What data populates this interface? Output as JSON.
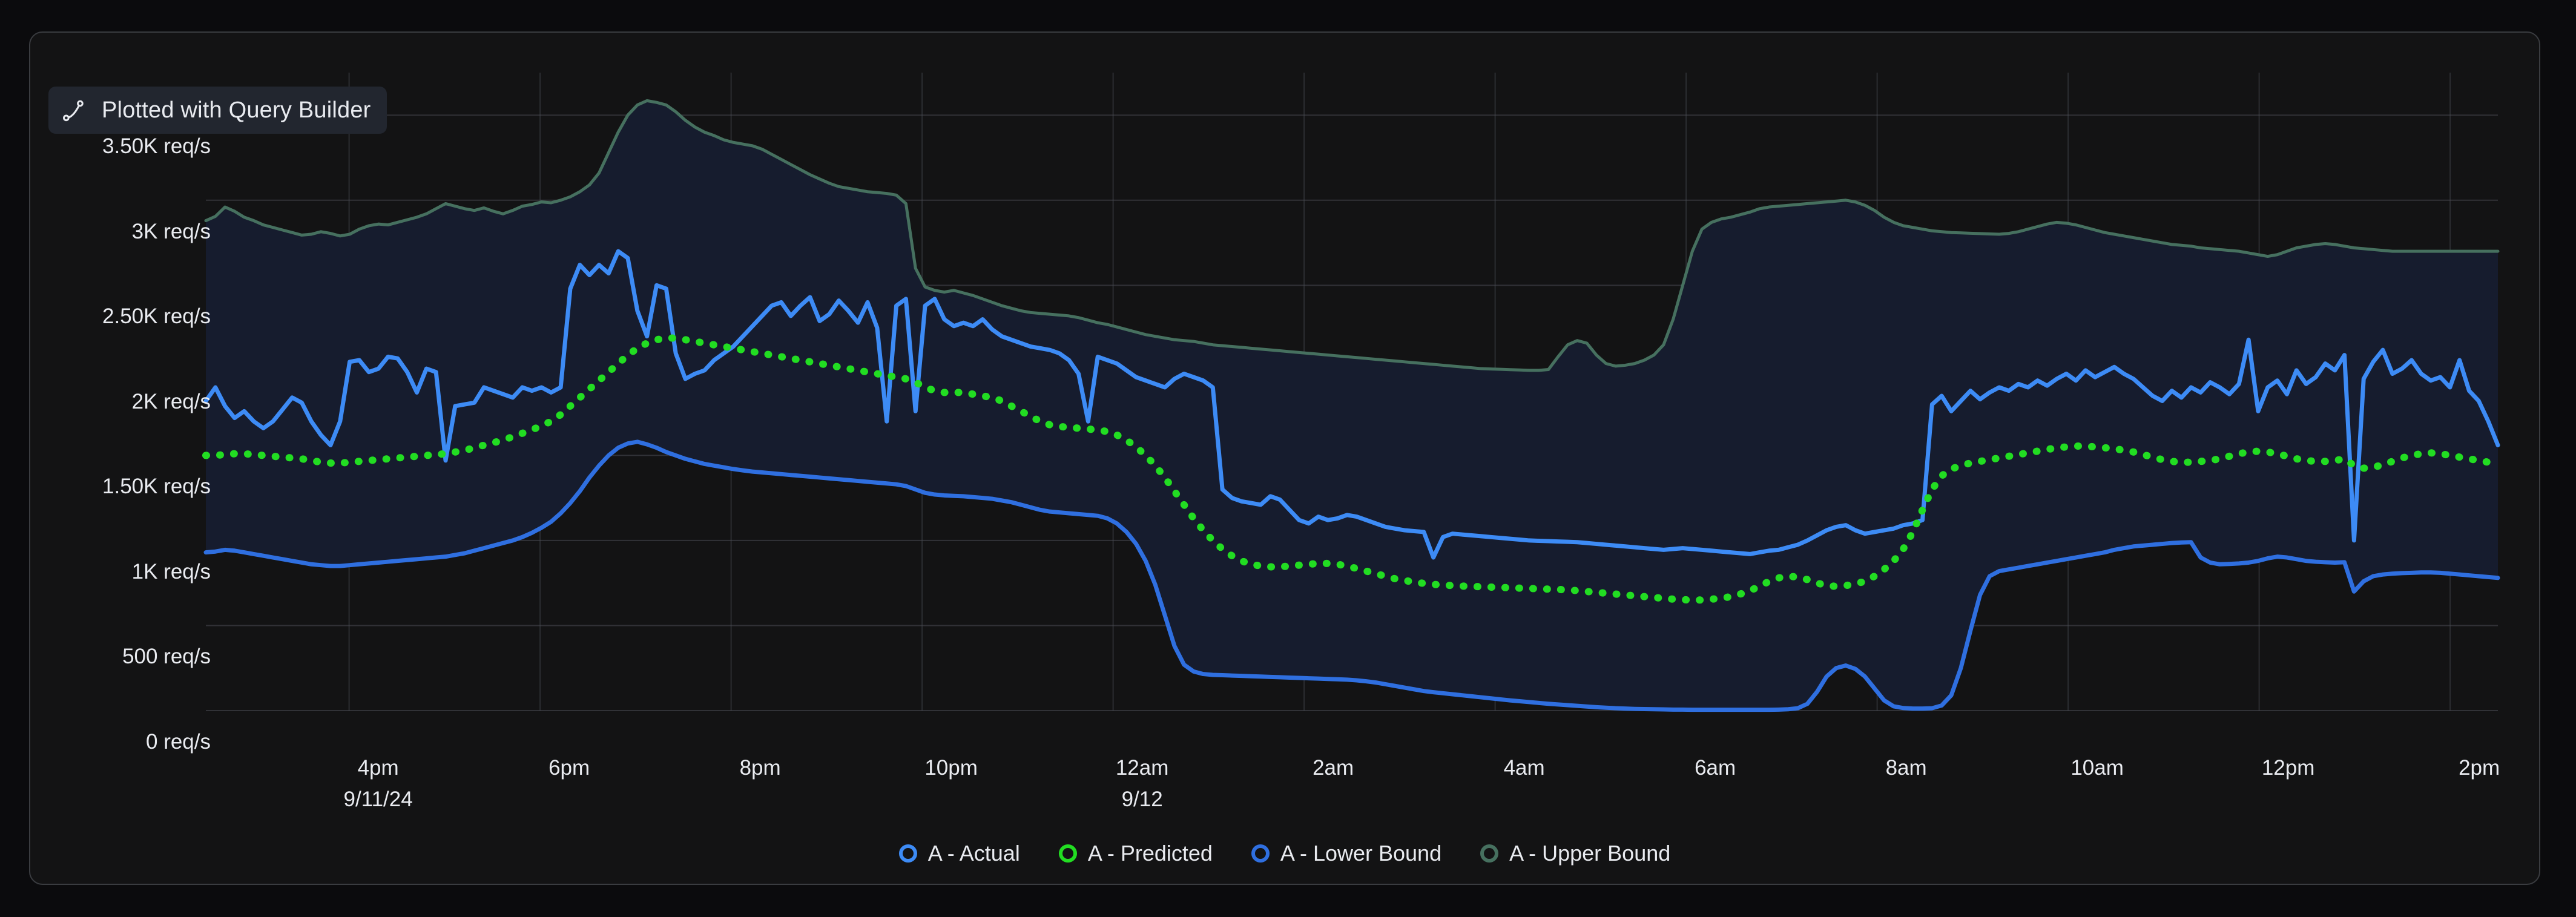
{
  "panel": {
    "badge": {
      "icon": "curve-plot-icon",
      "text": "Plotted with  Query Builder"
    }
  },
  "colors": {
    "page_background": "#0b0b0d",
    "panel_background": "#131314",
    "panel_border": "#3a3c40",
    "badge_background": "#22262f",
    "text": "#e9ebf0",
    "gridline": "#4a4d55",
    "band_fill": "#161c2e",
    "actual": "#3d8bf5",
    "predicted": "#22dd22",
    "lower_bound": "#2f6fe0",
    "upper_bound": "#46705f"
  },
  "chart_data": {
    "type": "line",
    "title": "",
    "subtitle": "",
    "xlabel": "",
    "ylabel": "req/s",
    "grid": true,
    "legend_position": "bottom",
    "ylim": [
      0,
      3750
    ],
    "yticks": [
      0,
      500,
      1000,
      1500,
      2000,
      2500,
      3000,
      3500
    ],
    "ytick_labels": [
      "0 req/s",
      "500 req/s",
      "1K req/s",
      "1.50K req/s",
      "2K req/s",
      "2.50K req/s",
      "3K req/s",
      "3.50K req/s"
    ],
    "x_start_hour": 14.5,
    "x_end_hour": 38.5,
    "xticks": [
      {
        "time": "4pm",
        "date": "9/11/24",
        "hour": 16
      },
      {
        "time": "6pm",
        "date": "",
        "hour": 18
      },
      {
        "time": "8pm",
        "date": "",
        "hour": 20
      },
      {
        "time": "10pm",
        "date": "",
        "hour": 22
      },
      {
        "time": "12am",
        "date": "9/12",
        "hour": 24
      },
      {
        "time": "2am",
        "date": "",
        "hour": 26
      },
      {
        "time": "4am",
        "date": "",
        "hour": 28
      },
      {
        "time": "6am",
        "date": "",
        "hour": 30
      },
      {
        "time": "8am",
        "date": "",
        "hour": 32
      },
      {
        "time": "10am",
        "date": "",
        "hour": 34
      },
      {
        "time": "12pm",
        "date": "",
        "hour": 36
      },
      {
        "time": "2pm",
        "date": "",
        "hour": 38
      }
    ],
    "legend": [
      {
        "label": "A - Actual",
        "color": "#3d8bf5"
      },
      {
        "label": "A - Predicted",
        "color": "#22dd22"
      },
      {
        "label": "A - Lower Bound",
        "color": "#2f6fe0"
      },
      {
        "label": "A - Upper Bound",
        "color": "#46705f"
      }
    ],
    "series": [
      {
        "name": "A - Upper Bound",
        "color": "#46705f",
        "style": "solid",
        "values": [
          2880,
          2905,
          2960,
          2935,
          2900,
          2880,
          2855,
          2840,
          2825,
          2810,
          2795,
          2800,
          2815,
          2805,
          2790,
          2800,
          2830,
          2850,
          2860,
          2855,
          2870,
          2885,
          2900,
          2920,
          2950,
          2980,
          2965,
          2950,
          2940,
          2955,
          2935,
          2920,
          2940,
          2965,
          2975,
          2990,
          2985,
          3000,
          3020,
          3050,
          3090,
          3160,
          3280,
          3400,
          3500,
          3560,
          3585,
          3575,
          3560,
          3520,
          3470,
          3430,
          3400,
          3380,
          3355,
          3340,
          3330,
          3320,
          3300,
          3270,
          3240,
          3210,
          3180,
          3150,
          3125,
          3100,
          3080,
          3070,
          3060,
          3050,
          3045,
          3040,
          3030,
          2980,
          2600,
          2490,
          2470,
          2460,
          2470,
          2455,
          2440,
          2420,
          2400,
          2380,
          2365,
          2350,
          2340,
          2335,
          2330,
          2325,
          2320,
          2310,
          2295,
          2280,
          2270,
          2255,
          2240,
          2225,
          2210,
          2200,
          2190,
          2180,
          2175,
          2170,
          2160,
          2150,
          2145,
          2140,
          2135,
          2130,
          2125,
          2120,
          2115,
          2110,
          2105,
          2100,
          2095,
          2090,
          2085,
          2080,
          2075,
          2070,
          2065,
          2060,
          2055,
          2050,
          2045,
          2040,
          2035,
          2030,
          2025,
          2020,
          2015,
          2010,
          2008,
          2006,
          2004,
          2002,
          2000,
          2000,
          2005,
          2080,
          2150,
          2175,
          2160,
          2090,
          2040,
          2025,
          2030,
          2040,
          2060,
          2090,
          2150,
          2300,
          2500,
          2700,
          2830,
          2870,
          2890,
          2900,
          2915,
          2930,
          2950,
          2960,
          2965,
          2970,
          2975,
          2980,
          2985,
          2990,
          2995,
          3000,
          2990,
          2970,
          2940,
          2900,
          2870,
          2850,
          2840,
          2830,
          2820,
          2815,
          2810,
          2808,
          2806,
          2804,
          2802,
          2800,
          2805,
          2815,
          2830,
          2845,
          2860,
          2870,
          2865,
          2855,
          2840,
          2825,
          2810,
          2800,
          2790,
          2780,
          2770,
          2760,
          2750,
          2740,
          2735,
          2730,
          2720,
          2715,
          2710,
          2705,
          2700,
          2690,
          2680,
          2670,
          2680,
          2700,
          2720,
          2730,
          2740,
          2745,
          2740,
          2730,
          2720,
          2715,
          2710,
          2705,
          2700,
          2700,
          2700,
          2700,
          2700,
          2700,
          2700,
          2700,
          2700,
          2700,
          2700,
          2700
        ]
      },
      {
        "name": "A - Actual",
        "color": "#3d8bf5",
        "style": "solid",
        "values": [
          1820,
          1900,
          1790,
          1720,
          1760,
          1700,
          1660,
          1700,
          1770,
          1840,
          1810,
          1700,
          1620,
          1560,
          1700,
          2050,
          2060,
          1990,
          2010,
          2080,
          2070,
          1990,
          1870,
          2010,
          1990,
          1470,
          1790,
          1800,
          1810,
          1900,
          1880,
          1860,
          1840,
          1900,
          1880,
          1900,
          1870,
          1900,
          2480,
          2620,
          2560,
          2620,
          2570,
          2700,
          2660,
          2350,
          2200,
          2500,
          2480,
          2100,
          1950,
          1980,
          2000,
          2060,
          2100,
          2140,
          2200,
          2260,
          2320,
          2380,
          2400,
          2320,
          2380,
          2430,
          2290,
          2330,
          2410,
          2350,
          2280,
          2400,
          2250,
          1700,
          2380,
          2420,
          1760,
          2380,
          2420,
          2300,
          2260,
          2280,
          2260,
          2300,
          2240,
          2200,
          2180,
          2160,
          2140,
          2130,
          2120,
          2100,
          2060,
          1980,
          1700,
          2080,
          2060,
          2040,
          2000,
          1960,
          1940,
          1920,
          1900,
          1950,
          1980,
          1960,
          1940,
          1900,
          1300,
          1250,
          1230,
          1220,
          1210,
          1260,
          1240,
          1180,
          1120,
          1100,
          1140,
          1120,
          1130,
          1150,
          1140,
          1120,
          1100,
          1080,
          1070,
          1060,
          1055,
          1050,
          900,
          1020,
          1040,
          1035,
          1030,
          1025,
          1020,
          1015,
          1010,
          1005,
          1000,
          998,
          996,
          994,
          992,
          990,
          985,
          980,
          975,
          970,
          965,
          960,
          955,
          950,
          945,
          950,
          955,
          950,
          945,
          940,
          935,
          930,
          925,
          920,
          930,
          940,
          945,
          960,
          975,
          1000,
          1030,
          1060,
          1080,
          1090,
          1060,
          1040,
          1050,
          1060,
          1070,
          1090,
          1100,
          1120,
          1800,
          1850,
          1760,
          1820,
          1880,
          1830,
          1870,
          1900,
          1880,
          1920,
          1900,
          1940,
          1910,
          1950,
          1980,
          1940,
          2000,
          1960,
          1990,
          2020,
          1980,
          1950,
          1900,
          1850,
          1820,
          1880,
          1840,
          1900,
          1870,
          1930,
          1900,
          1860,
          1920,
          2180,
          1760,
          1900,
          1940,
          1860,
          2000,
          1920,
          1960,
          2040,
          2000,
          2090,
          1000,
          1950,
          2050,
          2120,
          1980,
          2010,
          2060,
          1980,
          1940,
          1960,
          1900,
          2060,
          1880,
          1820,
          1700,
          1560
        ]
      },
      {
        "name": "A - Predicted",
        "color": "#22dd22",
        "style": "dotted",
        "values": [
          1500,
          1500,
          1505,
          1510,
          1510,
          1505,
          1500,
          1495,
          1490,
          1485,
          1480,
          1470,
          1460,
          1455,
          1455,
          1460,
          1465,
          1470,
          1475,
          1480,
          1485,
          1490,
          1495,
          1500,
          1505,
          1510,
          1520,
          1530,
          1545,
          1560,
          1575,
          1590,
          1610,
          1630,
          1650,
          1675,
          1700,
          1740,
          1790,
          1840,
          1890,
          1940,
          1990,
          2040,
          2090,
          2130,
          2160,
          2180,
          2190,
          2190,
          2180,
          2170,
          2160,
          2150,
          2140,
          2130,
          2120,
          2110,
          2100,
          2090,
          2080,
          2070,
          2060,
          2050,
          2040,
          2030,
          2020,
          2010,
          2000,
          1990,
          1980,
          1970,
          1960,
          1950,
          1930,
          1900,
          1880,
          1870,
          1870,
          1870,
          1860,
          1850,
          1840,
          1820,
          1790,
          1760,
          1730,
          1700,
          1680,
          1670,
          1665,
          1660,
          1655,
          1650,
          1640,
          1620,
          1590,
          1550,
          1500,
          1440,
          1370,
          1290,
          1210,
          1130,
          1060,
          1000,
          950,
          910,
          880,
          860,
          850,
          845,
          845,
          850,
          855,
          860,
          865,
          865,
          860,
          850,
          835,
          820,
          805,
          790,
          775,
          765,
          755,
          748,
          742,
          738,
          735,
          732,
          730,
          728,
          726,
          724,
          722,
          720,
          718,
          716,
          714,
          712,
          710,
          705,
          700,
          695,
          690,
          685,
          680,
          675,
          670,
          665,
          660,
          655,
          652,
          650,
          650,
          655,
          660,
          670,
          685,
          705,
          730,
          760,
          780,
          790,
          785,
          770,
          750,
          735,
          730,
          735,
          745,
          760,
          790,
          830,
          880,
          950,
          1050,
          1180,
          1300,
          1380,
          1420,
          1440,
          1455,
          1465,
          1475,
          1485,
          1495,
          1505,
          1515,
          1525,
          1535,
          1545,
          1550,
          1555,
          1555,
          1550,
          1545,
          1540,
          1530,
          1520,
          1505,
          1490,
          1475,
          1465,
          1460,
          1460,
          1465,
          1470,
          1480,
          1495,
          1510,
          1520,
          1525,
          1520,
          1510,
          1495,
          1480,
          1470,
          1465,
          1465,
          1470,
          1480,
          1440,
          1425,
          1430,
          1445,
          1465,
          1485,
          1500,
          1510,
          1515,
          1510,
          1500,
          1490,
          1480,
          1470,
          1460,
          1450
        ]
      },
      {
        "name": "A - Lower Bound",
        "color": "#2f6fe0",
        "style": "solid",
        "values": [
          930,
          935,
          945,
          940,
          930,
          920,
          910,
          900,
          890,
          880,
          870,
          860,
          855,
          850,
          850,
          855,
          860,
          865,
          870,
          875,
          880,
          885,
          890,
          895,
          900,
          905,
          915,
          925,
          940,
          955,
          970,
          985,
          1000,
          1020,
          1045,
          1075,
          1110,
          1160,
          1220,
          1290,
          1370,
          1440,
          1500,
          1545,
          1570,
          1580,
          1565,
          1545,
          1520,
          1500,
          1480,
          1465,
          1450,
          1440,
          1430,
          1420,
          1412,
          1405,
          1400,
          1395,
          1390,
          1385,
          1380,
          1375,
          1370,
          1365,
          1360,
          1355,
          1350,
          1345,
          1340,
          1335,
          1330,
          1320,
          1300,
          1280,
          1270,
          1265,
          1262,
          1260,
          1255,
          1250,
          1245,
          1235,
          1225,
          1210,
          1195,
          1180,
          1170,
          1165,
          1160,
          1155,
          1150,
          1145,
          1130,
          1100,
          1050,
          980,
          880,
          740,
          560,
          380,
          270,
          230,
          215,
          210,
          208,
          206,
          204,
          202,
          200,
          198,
          196,
          194,
          192,
          190,
          188,
          186,
          184,
          182,
          178,
          172,
          165,
          155,
          145,
          135,
          125,
          115,
          108,
          102,
          96,
          90,
          84,
          78,
          72,
          66,
          60,
          55,
          50,
          45,
          40,
          36,
          32,
          28,
          24,
          20,
          17,
          14,
          12,
          10,
          9,
          8,
          7,
          6,
          6,
          5,
          5,
          5,
          5,
          5,
          5,
          5,
          5,
          5,
          6,
          8,
          14,
          40,
          110,
          200,
          250,
          265,
          245,
          200,
          130,
          60,
          25,
          15,
          12,
          12,
          14,
          30,
          90,
          250,
          470,
          680,
          790,
          820,
          830,
          840,
          850,
          860,
          870,
          880,
          890,
          900,
          910,
          920,
          930,
          945,
          955,
          965,
          970,
          975,
          980,
          985,
          988,
          990,
          900,
          870,
          860,
          862,
          865,
          870,
          880,
          895,
          905,
          900,
          890,
          880,
          875,
          872,
          870,
          872,
          700,
          760,
          790,
          800,
          805,
          808,
          810,
          812,
          812,
          810,
          805,
          800,
          795,
          790,
          785,
          780
        ]
      }
    ]
  }
}
